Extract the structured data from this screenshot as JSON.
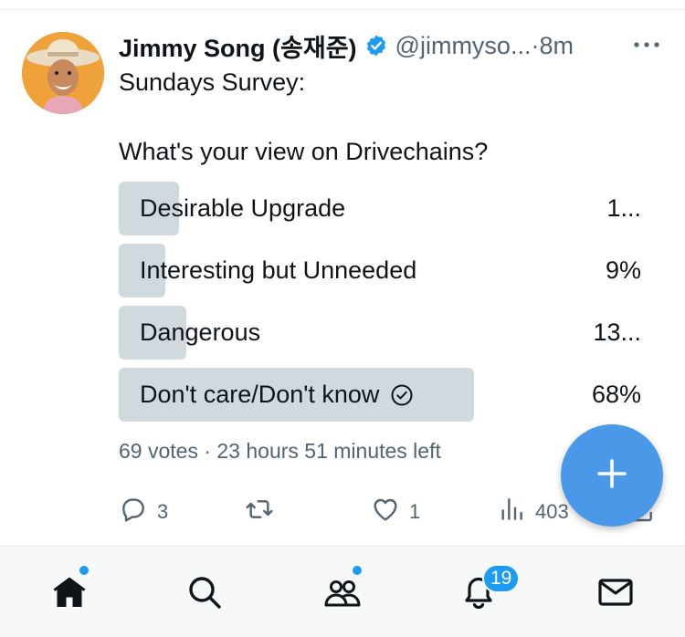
{
  "tweet": {
    "author_name": "Jimmy Song (송재준)",
    "handle": "@jimmyso...",
    "separator": "·",
    "time": "8m",
    "text_line1": "Sundays Survey:",
    "text_line2": "What's your view on Drivechains?",
    "poll": {
      "options": [
        {
          "label": "Desirable Upgrade",
          "percent_text": "1...",
          "fill_fraction": 0.115
        },
        {
          "label": "Interesting but Unneeded",
          "percent_text": "9%",
          "fill_fraction": 0.09
        },
        {
          "label": "Dangerous",
          "percent_text": "13...",
          "fill_fraction": 0.13
        },
        {
          "label": "Don't care/Don't know",
          "percent_text": "68%",
          "fill_fraction": 0.68,
          "winner": true
        }
      ],
      "meta": "69 votes · 23 hours 51 minutes left"
    },
    "actions": {
      "reply_count": "3",
      "like_count": "1",
      "views_count": "403"
    }
  },
  "nav": {
    "notifications_badge": "19"
  },
  "colors": {
    "accent": "#1d9bf0",
    "fab": "#4a99e9",
    "poll_fill": "#cfd9de",
    "muted_text": "#536471"
  }
}
